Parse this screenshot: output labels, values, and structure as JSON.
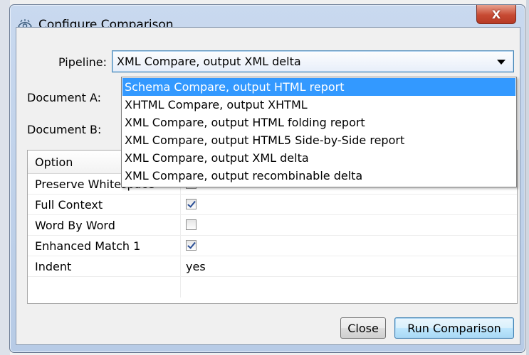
{
  "window": {
    "title": "Configure Comparison",
    "close_glyph": "X"
  },
  "pipeline": {
    "label": "Pipeline:",
    "value": "XML Compare, output XML delta",
    "options": [
      "Schema Compare, output HTML report",
      "XHTML Compare, output XHTML",
      "XML Compare, output HTML folding report",
      "XML Compare, output HTML5 Side-by-Side report",
      "XML Compare, output XML delta",
      "XML Compare, output recombinable delta"
    ],
    "highlighted_option": "Schema Compare, output HTML report"
  },
  "document_a": {
    "label": "Document A:"
  },
  "document_b": {
    "label": "Document B:"
  },
  "options_table": {
    "header_option": "Option",
    "rows": [
      {
        "name": "Preserve Whitespace",
        "type": "checkbox",
        "checked": false
      },
      {
        "name": "Full Context",
        "type": "checkbox",
        "checked": true
      },
      {
        "name": "Word By Word",
        "type": "checkbox",
        "checked": false
      },
      {
        "name": "Enhanced Match 1",
        "type": "checkbox",
        "checked": true
      },
      {
        "name": "Indent",
        "type": "text",
        "value": "yes"
      }
    ]
  },
  "buttons": {
    "close": "Close",
    "run": "Run Comparison"
  },
  "colors": {
    "selection": "#3399ff",
    "title_bar": "#c9d9ef",
    "close_button": "#c74a33"
  },
  "icons": {
    "title_icon": "eye-compare-icon",
    "combo_arrow": "chevron-down-icon"
  }
}
